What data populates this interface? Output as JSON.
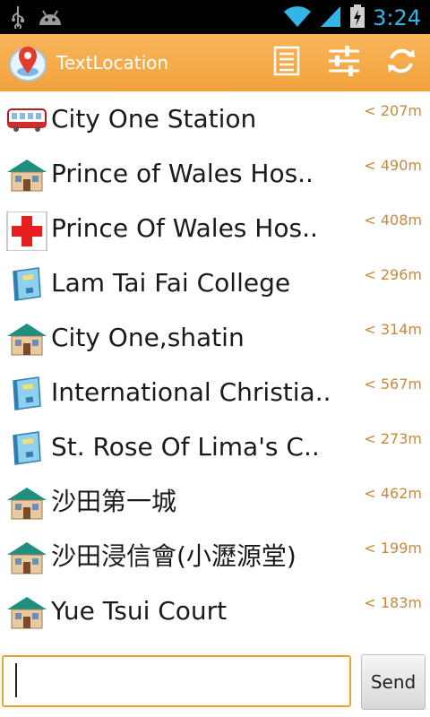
{
  "status_bar": {
    "time": "3:24",
    "icons": [
      "usb-icon",
      "android-debug-icon",
      "wifi-icon",
      "signal-icon",
      "battery-charging-icon"
    ]
  },
  "action_bar": {
    "title": "TextLocation",
    "app_icon": "map-pin-icon",
    "buttons": [
      "list-icon",
      "sliders-icon",
      "refresh-icon"
    ]
  },
  "places": [
    {
      "icon": "train-icon",
      "name": "City One Station",
      "distance": "< 207m"
    },
    {
      "icon": "house-icon",
      "name": "Prince of Wales Hos..",
      "distance": "< 490m"
    },
    {
      "icon": "hospital-cross-icon",
      "name": "Prince Of Wales Hos..",
      "distance": "< 408m"
    },
    {
      "icon": "school-book-icon",
      "name": "Lam Tai Fai College",
      "distance": "< 296m"
    },
    {
      "icon": "house-icon",
      "name": "City One,shatin",
      "distance": "< 314m"
    },
    {
      "icon": "school-book-icon",
      "name": "International Christia..",
      "distance": "< 567m"
    },
    {
      "icon": "school-book-icon",
      "name": "St. Rose Of Lima's C..",
      "distance": "< 273m"
    },
    {
      "icon": "house-icon",
      "name": "沙田第一城",
      "distance": "< 462m"
    },
    {
      "icon": "house-icon",
      "name": "沙田浸信會(小瀝源堂)",
      "distance": "< 199m"
    },
    {
      "icon": "house-icon",
      "name": "Yue Tsui Court",
      "distance": "< 183m"
    }
  ],
  "composer": {
    "input_value": "",
    "send_label": "Send"
  },
  "colors": {
    "action_bar": "#f2a23c",
    "accent_border": "#f0a030",
    "distance_text": "#c7893a",
    "status_icons": "#33b5e5"
  }
}
